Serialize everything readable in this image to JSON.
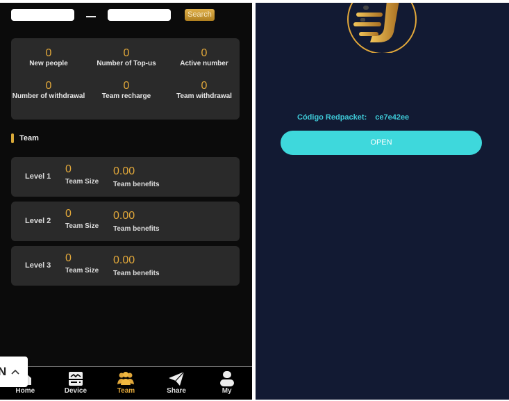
{
  "left": {
    "search": {
      "from_value": "",
      "to_value": "",
      "button": "Search"
    },
    "stats": [
      {
        "value": "0",
        "label": "New people"
      },
      {
        "value": "0",
        "label": "Number of Top-us"
      },
      {
        "value": "0",
        "label": "Active number"
      },
      {
        "value": "0",
        "label": "Number of withdrawal"
      },
      {
        "value": "0",
        "label": "Team recharge"
      },
      {
        "value": "0",
        "label": "Team withdrawal"
      }
    ],
    "team_title": "Team",
    "levels": [
      {
        "label": "Level 1",
        "size": "0",
        "size_label": "Team Size",
        "benefits": "0.00",
        "benefits_label": "Team benefits"
      },
      {
        "label": "Level 2",
        "size": "0",
        "size_label": "Team Size",
        "benefits": "0.00",
        "benefits_label": "Team benefits"
      },
      {
        "label": "Level 3",
        "size": "0",
        "size_label": "Team Size",
        "benefits": "0.00",
        "benefits_label": "Team benefits"
      }
    ],
    "nav": [
      {
        "label": "Home",
        "icon": "home-icon"
      },
      {
        "label": "Device",
        "icon": "device-icon"
      },
      {
        "label": "Team",
        "icon": "team-icon",
        "active": true
      },
      {
        "label": "Share",
        "icon": "paper-plane-icon"
      },
      {
        "label": "My",
        "icon": "user-icon"
      }
    ],
    "overlay": {
      "text": "N",
      "icon": "chevron-up-icon"
    }
  },
  "right": {
    "code_label": "Código Redpacket:",
    "code_value": "ce7e42ee",
    "open_button": "OPEN"
  },
  "colors": {
    "accent": "#e2a83a",
    "cyan": "#3ed8dc",
    "navy": "#121a33"
  }
}
